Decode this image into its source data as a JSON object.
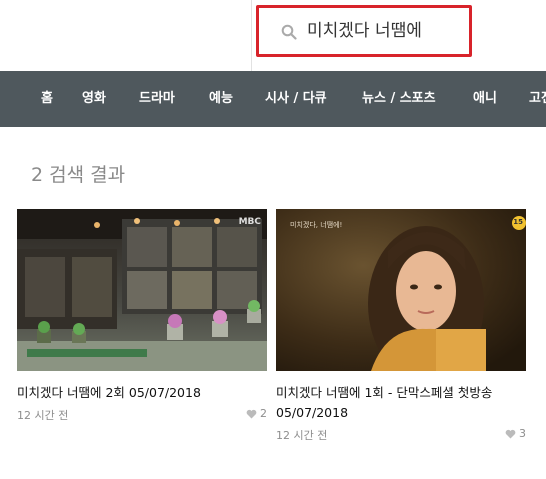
{
  "search": {
    "query": "미치겠다 너땜에"
  },
  "nav": {
    "items": [
      {
        "label": "홈"
      },
      {
        "label": "영화"
      },
      {
        "label": "드라마"
      },
      {
        "label": "예능"
      },
      {
        "label": "시사 / 다큐"
      },
      {
        "label": "뉴스 / 스포츠"
      },
      {
        "label": "애니"
      },
      {
        "label": "고전"
      }
    ]
  },
  "results": {
    "heading": "2 검색 결과",
    "items": [
      {
        "title": "미치겠다 너땜에 2회 05/07/2018",
        "time": "12 시간 전",
        "likes": "2",
        "thumb_watermark": "MBC"
      },
      {
        "title": "미치겠다 너땜에 1회 - 단막스페셜 첫방송 05/07/2018",
        "time": "12 시간 전",
        "likes": "3",
        "thumb_caption": "미치겠다, 너땜에!",
        "thumb_badge": "15"
      }
    ]
  },
  "colors": {
    "nav_bg": "#4f585d",
    "search_border": "#d8232a",
    "heading": "#8a8a8a"
  }
}
